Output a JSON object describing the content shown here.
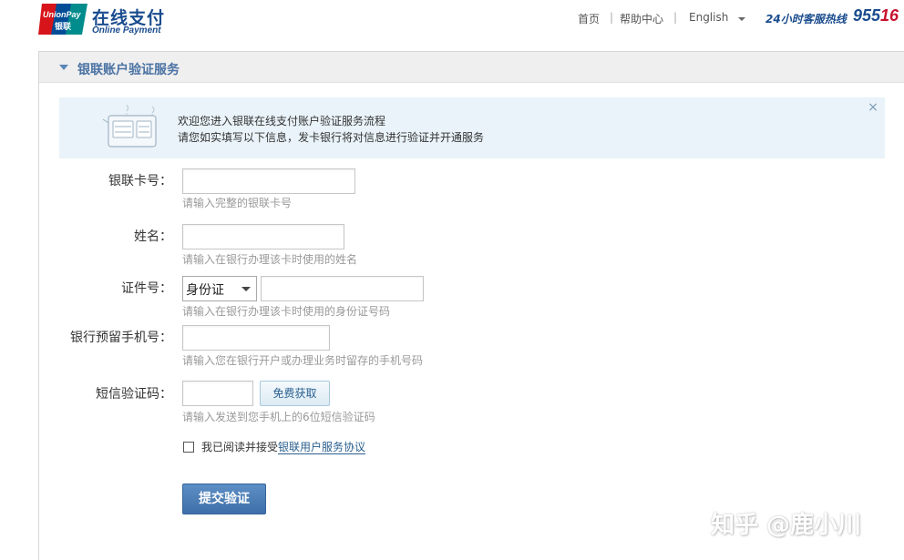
{
  "header": {
    "logo_badge_top": "UnionPay",
    "logo_badge_bottom": "银联",
    "logo_cn": "在线支付",
    "logo_en": "Online Payment",
    "nav": {
      "home": "首页",
      "separator": "|",
      "help": "帮助中心",
      "language": "English"
    },
    "hotline_label": "24小时客服热线",
    "hotline_prefix": "955",
    "hotline_suffix": "16"
  },
  "panel": {
    "title": "银联账户验证服务"
  },
  "notice": {
    "line1": "欢迎您进入银联在线支付账户验证服务流程",
    "line2": "请您如实填写以下信息，发卡银行将对信息进行验证并开通服务",
    "illustration_icon": "card-reader-icon",
    "close_glyph": "×"
  },
  "form": {
    "card": {
      "label": "银联卡号：",
      "value": "",
      "hint": "请输入完整的银联卡号"
    },
    "name": {
      "label": "姓名：",
      "value": "",
      "hint": "请输入在银行办理该卡时使用的姓名"
    },
    "id": {
      "label": "证件号：",
      "type_selected": "身份证",
      "value": "",
      "hint": "请输入在银行办理该卡时使用的身份证号码"
    },
    "phone": {
      "label": "银行预留手机号：",
      "value": "",
      "hint": "请输入您在银行开户或办理业务时留存的手机号码"
    },
    "sms": {
      "label": "短信验证码：",
      "value": "",
      "button": "免费获取",
      "hint": "请输入发送到您手机上的6位短信验证码"
    },
    "agreement": {
      "prefix": "我已阅读并接受",
      "link": "银联用户服务协议",
      "checked": false
    },
    "submit": "提交验证"
  },
  "watermark": "知乎 @鹿小川",
  "colors": {
    "brand_blue": "#1a4c8e",
    "brand_red": "#c8102e",
    "notice_bg": "#e9f3f9",
    "submit_bg": "#4a7db8"
  }
}
